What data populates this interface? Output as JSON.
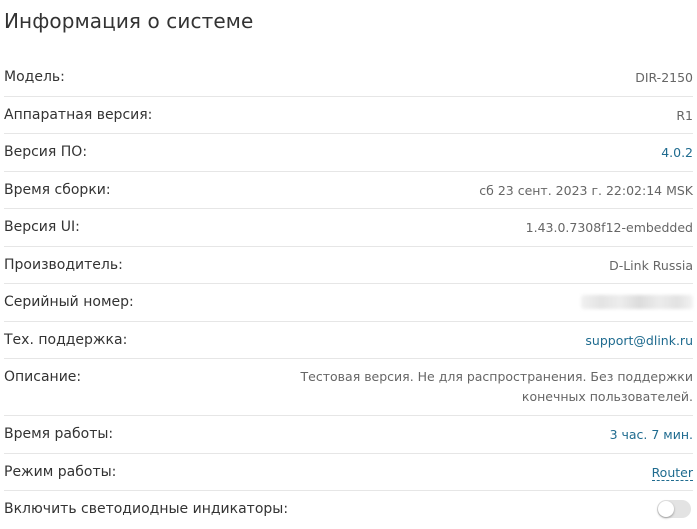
{
  "page": {
    "title": "Информация о системе"
  },
  "info": {
    "model": {
      "label": "Модель:",
      "value": "DIR-2150"
    },
    "hw_version": {
      "label": "Аппаратная версия:",
      "value": "R1"
    },
    "fw_version": {
      "label": "Версия ПО:",
      "value": "4.0.2"
    },
    "build_time": {
      "label": "Время сборки:",
      "value": "сб 23 сент. 2023 г. 22:02:14 MSK"
    },
    "ui_version": {
      "label": "Версия UI:",
      "value": "1.43.0.7308f12-embedded"
    },
    "vendor": {
      "label": "Производитель:",
      "value": "D-Link Russia"
    },
    "serial": {
      "label": "Серийный номер:"
    },
    "support": {
      "label": "Тех. поддержка:",
      "value": "support@dlink.ru"
    },
    "description": {
      "label": "Описание:",
      "line1": "Тестовая версия. Не для распространения. Без поддержки",
      "line2": "конечных пользователей."
    },
    "uptime": {
      "label": "Время работы:",
      "value": "3 час. 7 мин."
    },
    "mode": {
      "label": "Режим работы:",
      "value": "Router"
    },
    "leds": {
      "label": "Включить светодиодные индикаторы:",
      "enabled": false
    }
  },
  "colors": {
    "link": "#1f6b8f",
    "text": "#333333",
    "muted": "#666666",
    "divider": "#e6e6e6"
  }
}
